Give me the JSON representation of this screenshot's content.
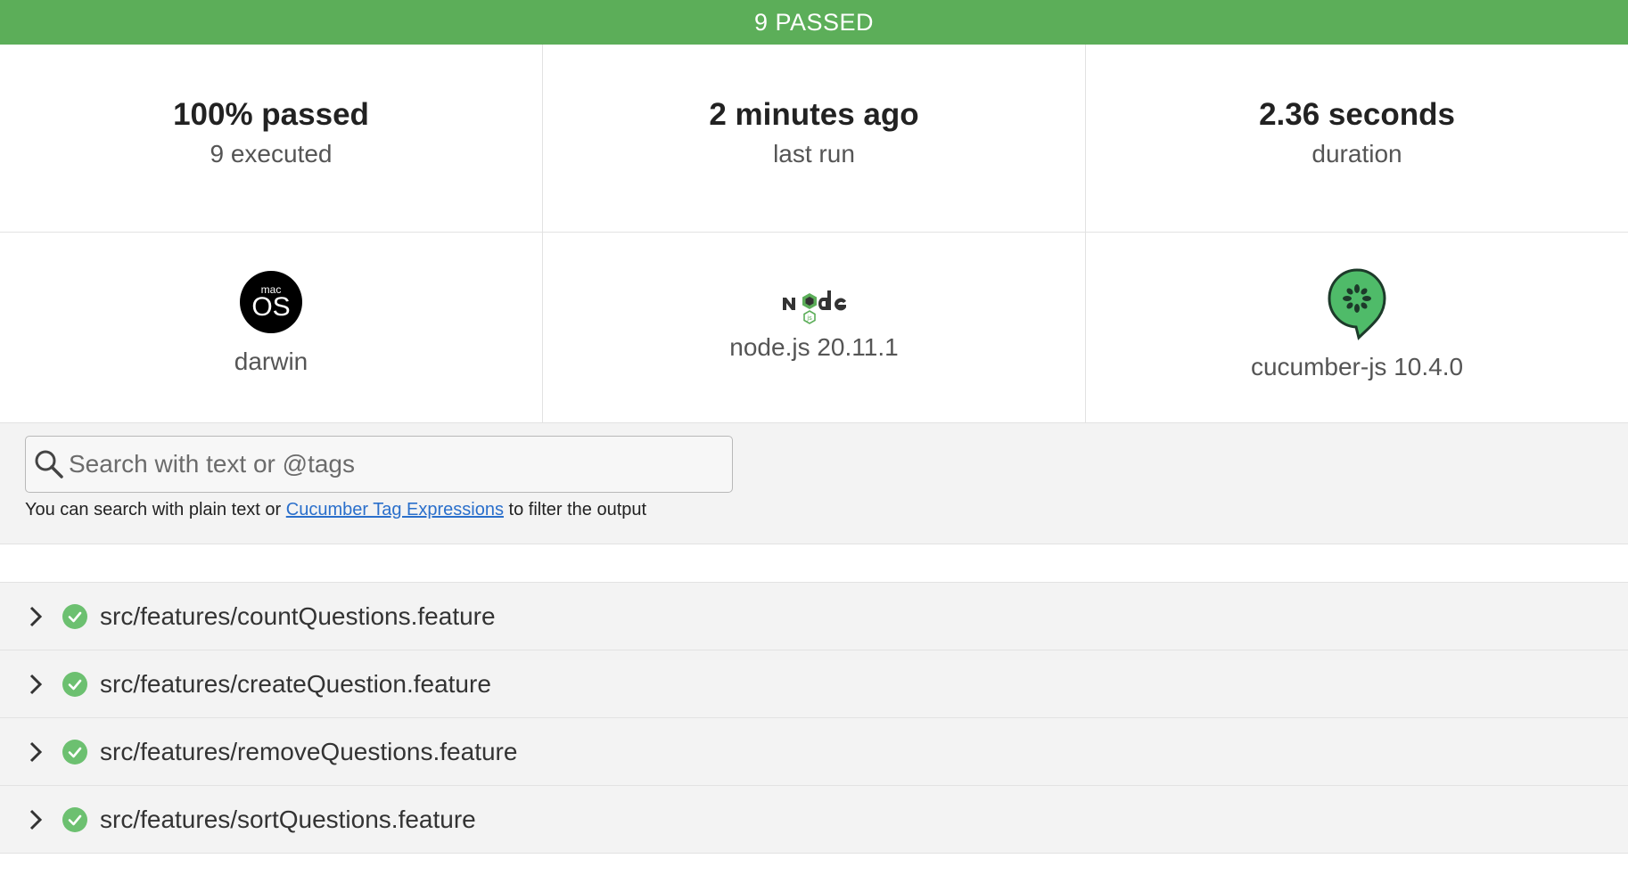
{
  "banner": {
    "text": "9 PASSED",
    "color": "#5cae59"
  },
  "stats": [
    {
      "main": "100% passed",
      "sub": "9 executed"
    },
    {
      "main": "2 minutes ago",
      "sub": "last run"
    },
    {
      "main": "2.36 seconds",
      "sub": "duration"
    }
  ],
  "environment": {
    "os": {
      "icon": "macos-icon",
      "icon_text_small": "mac",
      "icon_text_large": "OS",
      "label": "darwin"
    },
    "runtime": {
      "icon": "nodejs-icon",
      "label": "node.js 20.11.1"
    },
    "tool": {
      "icon": "cucumber-icon",
      "label": "cucumber-js 10.4.0"
    }
  },
  "search": {
    "placeholder": "Search with text or @tags",
    "help_prefix": "You can search with plain text or ",
    "help_link": "Cucumber Tag Expressions",
    "help_suffix": " to filter the output"
  },
  "features": [
    {
      "name": "src/features/countQuestions.feature",
      "status": "passed"
    },
    {
      "name": "src/features/createQuestion.feature",
      "status": "passed"
    },
    {
      "name": "src/features/removeQuestions.feature",
      "status": "passed"
    },
    {
      "name": "src/features/sortQuestions.feature",
      "status": "passed"
    }
  ],
  "colors": {
    "passed": "#5cae59",
    "check": "#6cc070",
    "link": "#2a6fcb"
  }
}
